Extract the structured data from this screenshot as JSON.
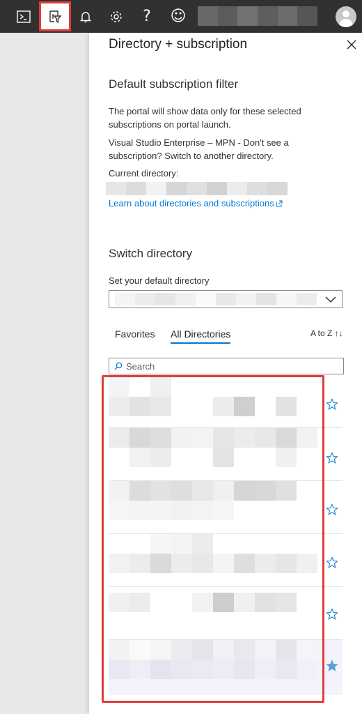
{
  "topbar": {
    "icons": [
      "cloud-shell-icon",
      "directory-filter-icon",
      "notifications-icon",
      "settings-icon",
      "help-icon",
      "feedback-icon"
    ],
    "help_glyph": "?",
    "feedback_glyph": "☺"
  },
  "panel": {
    "title": "Directory + subscription",
    "default_filter_heading": "Default subscription filter",
    "filter_description": "The portal will show data only for these selected subscriptions on portal launch.",
    "subscription_note": "Visual Studio Enterprise – MPN - Don't see a subscription? Switch to another directory.",
    "current_directory_label": "Current directory:",
    "learn_link": "Learn about directories and subscriptions",
    "switch_heading": "Switch directory",
    "default_directory_label": "Set your default directory",
    "tabs": {
      "favorites": "Favorites",
      "all": "All Directories"
    },
    "sort_label": "A to Z ↑↓",
    "search_placeholder": "Search",
    "directory_rows": [
      {
        "favorite": false
      },
      {
        "favorite": false
      },
      {
        "favorite": false
      },
      {
        "favorite": false
      },
      {
        "favorite": false
      },
      {
        "favorite": true
      }
    ]
  },
  "colors": {
    "accent": "#0078d4",
    "highlight": "#e03c3c",
    "topbar_bg": "#323130"
  }
}
